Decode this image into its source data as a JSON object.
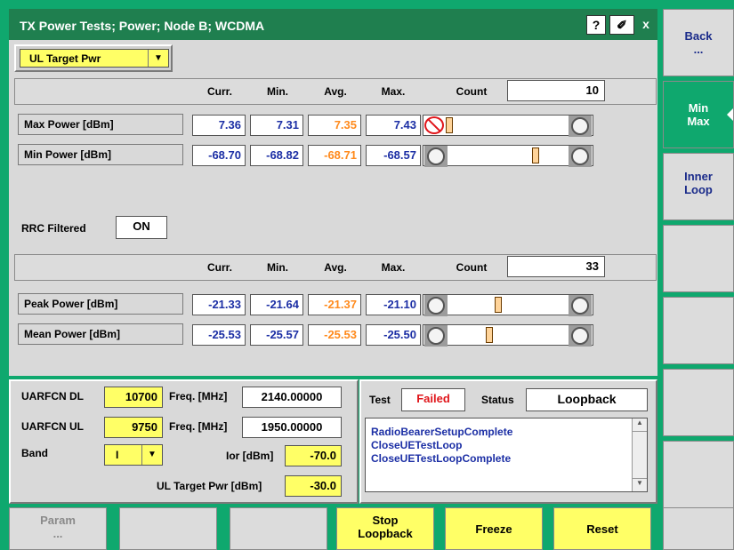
{
  "window": {
    "title": "TX Power Tests; Power; Node B; WCDMA",
    "help_label": "?",
    "tools_label": "✐",
    "close_label": "x"
  },
  "selector": {
    "value": "UL Target Pwr"
  },
  "table1": {
    "columns": [
      "Curr.",
      "Min.",
      "Avg.",
      "Max."
    ],
    "count_label": "Count",
    "count_value": "10",
    "rows": [
      {
        "label": "Max Power [dBm]",
        "curr": "7.36",
        "min": "7.31",
        "avg": "7.35",
        "max": "7.43",
        "level": 0.0
      },
      {
        "label": "Min Power  [dBm]",
        "curr": "-68.70",
        "min": "-68.82",
        "avg": "-68.71",
        "max": "-68.57",
        "level": 0.6
      }
    ]
  },
  "rrc": {
    "label": "RRC Filtered",
    "value": "ON"
  },
  "table2": {
    "columns": [
      "Curr.",
      "Min.",
      "Avg.",
      "Max."
    ],
    "count_label": "Count",
    "count_value": "33",
    "rows": [
      {
        "label": "Peak Power  [dBm]",
        "curr": "-21.33",
        "min": "-21.64",
        "avg": "-21.37",
        "max": "-21.10",
        "level": 0.43
      },
      {
        "label": "Mean Power [dBm]",
        "curr": "-25.53",
        "min": "-25.57",
        "avg": "-25.53",
        "max": "-25.50",
        "level": 0.36
      }
    ]
  },
  "settings": {
    "uarfcn_dl_label": "UARFCN DL",
    "uarfcn_dl": "10700",
    "freq_label": "Freq. [MHz]",
    "freq_dl": "2140.00000",
    "uarfcn_ul_label": "UARFCN UL",
    "uarfcn_ul": "9750",
    "freq_ul": "1950.00000",
    "band_label": "Band",
    "band": "I",
    "ior_label": "Ior [dBm]",
    "ior": "-70.0",
    "ul_target_label": "UL Target Pwr [dBm]",
    "ul_target": "-30.0"
  },
  "status": {
    "test_label": "Test",
    "test_value": "Failed",
    "status_label": "Status",
    "status_value": "Loopback",
    "messages": [
      "RadioBearerSetupComplete",
      "CloseUETestLoop",
      "CloseUETestLoopComplete"
    ]
  },
  "side_menu": [
    {
      "label": "Back",
      "sub": "...",
      "active": false
    },
    {
      "label": "Min",
      "sub": "Max",
      "active": true
    },
    {
      "label": "Inner",
      "sub": "Loop",
      "active": false
    },
    {
      "label": "",
      "sub": "",
      "active": false
    },
    {
      "label": "",
      "sub": "",
      "active": false
    },
    {
      "label": "",
      "sub": "",
      "active": false
    },
    {
      "label": "",
      "sub": "",
      "active": false
    }
  ],
  "softkeys": [
    {
      "label": "Param",
      "sub": "...",
      "style": "g"
    },
    {
      "label": "",
      "sub": "",
      "style": ""
    },
    {
      "label": "",
      "sub": "",
      "style": ""
    },
    {
      "label": "Stop",
      "sub": "Loopback",
      "style": "y"
    },
    {
      "label": "Freeze",
      "sub": "",
      "style": "y"
    },
    {
      "label": "Reset",
      "sub": "",
      "style": "y"
    },
    {
      "label": "",
      "sub": "",
      "style": ""
    }
  ],
  "colors": {
    "accent_green": "#0fa86e",
    "title_green": "#1f7f4f",
    "value_blue": "#1c2fa5",
    "avg_orange": "#ff8a1c",
    "failed_red": "#e0161b",
    "softkey_yellow": "#ffff66"
  }
}
